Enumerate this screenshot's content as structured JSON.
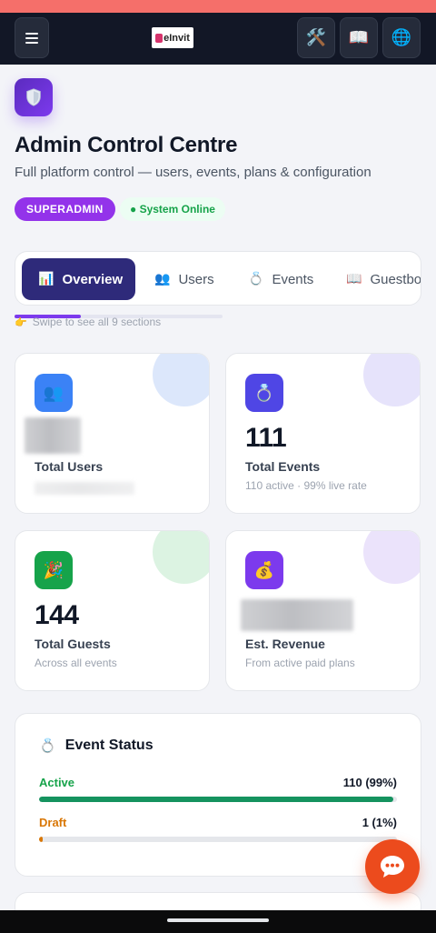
{
  "header": {
    "menu_icon": "hamburger-icon",
    "logo_text": "eInvit",
    "tools_icon": "🛠️",
    "book_icon": "📖",
    "globe_icon": "🌐"
  },
  "page": {
    "icon": "shield-icon",
    "title": "Admin Control Centre",
    "subtitle": "Full platform control — users, events, plans & configuration",
    "role_badge": "SUPERADMIN",
    "status_badge": "● System Online"
  },
  "tabs": [
    {
      "icon": "📊",
      "label": "Overview",
      "active": true
    },
    {
      "icon": "👥",
      "label": "Users",
      "active": false
    },
    {
      "icon": "💍",
      "label": "Events",
      "active": false
    },
    {
      "icon": "📖",
      "label": "Guestbook",
      "active": false
    }
  ],
  "swipe": {
    "icon": "👉",
    "hint": "Swipe to see all 9 sections",
    "progress": 0.32
  },
  "stats": [
    {
      "icon": "👥",
      "value": "",
      "label": "Total Users",
      "sub": "",
      "color": "#3b82f6",
      "value_hidden": true
    },
    {
      "icon": "💍",
      "value": "111",
      "label": "Total Events",
      "sub": "110 active · 99% live rate",
      "color": "#4f46e5"
    },
    {
      "icon": "🎉",
      "value": "144",
      "label": "Total Guests",
      "sub": "Across all events",
      "color": "#16a34a"
    },
    {
      "icon": "💰",
      "value": "",
      "label": "Est. Revenue",
      "sub": "From active paid plans",
      "color": "#7c3aed",
      "value_hidden": true
    }
  ],
  "event_status": {
    "icon": "💍",
    "title": "Event Status",
    "rows": [
      {
        "label": "Active",
        "value": "110 (99%)",
        "fraction": 0.99,
        "color": "#16a34a",
        "bar_color": "#15935f"
      },
      {
        "label": "Draft",
        "value": "1 (1%)",
        "fraction": 0.01,
        "color": "#d97706",
        "bar_color": "#d97706"
      }
    ]
  },
  "chat": {
    "icon": "chat-bubble-icon"
  }
}
